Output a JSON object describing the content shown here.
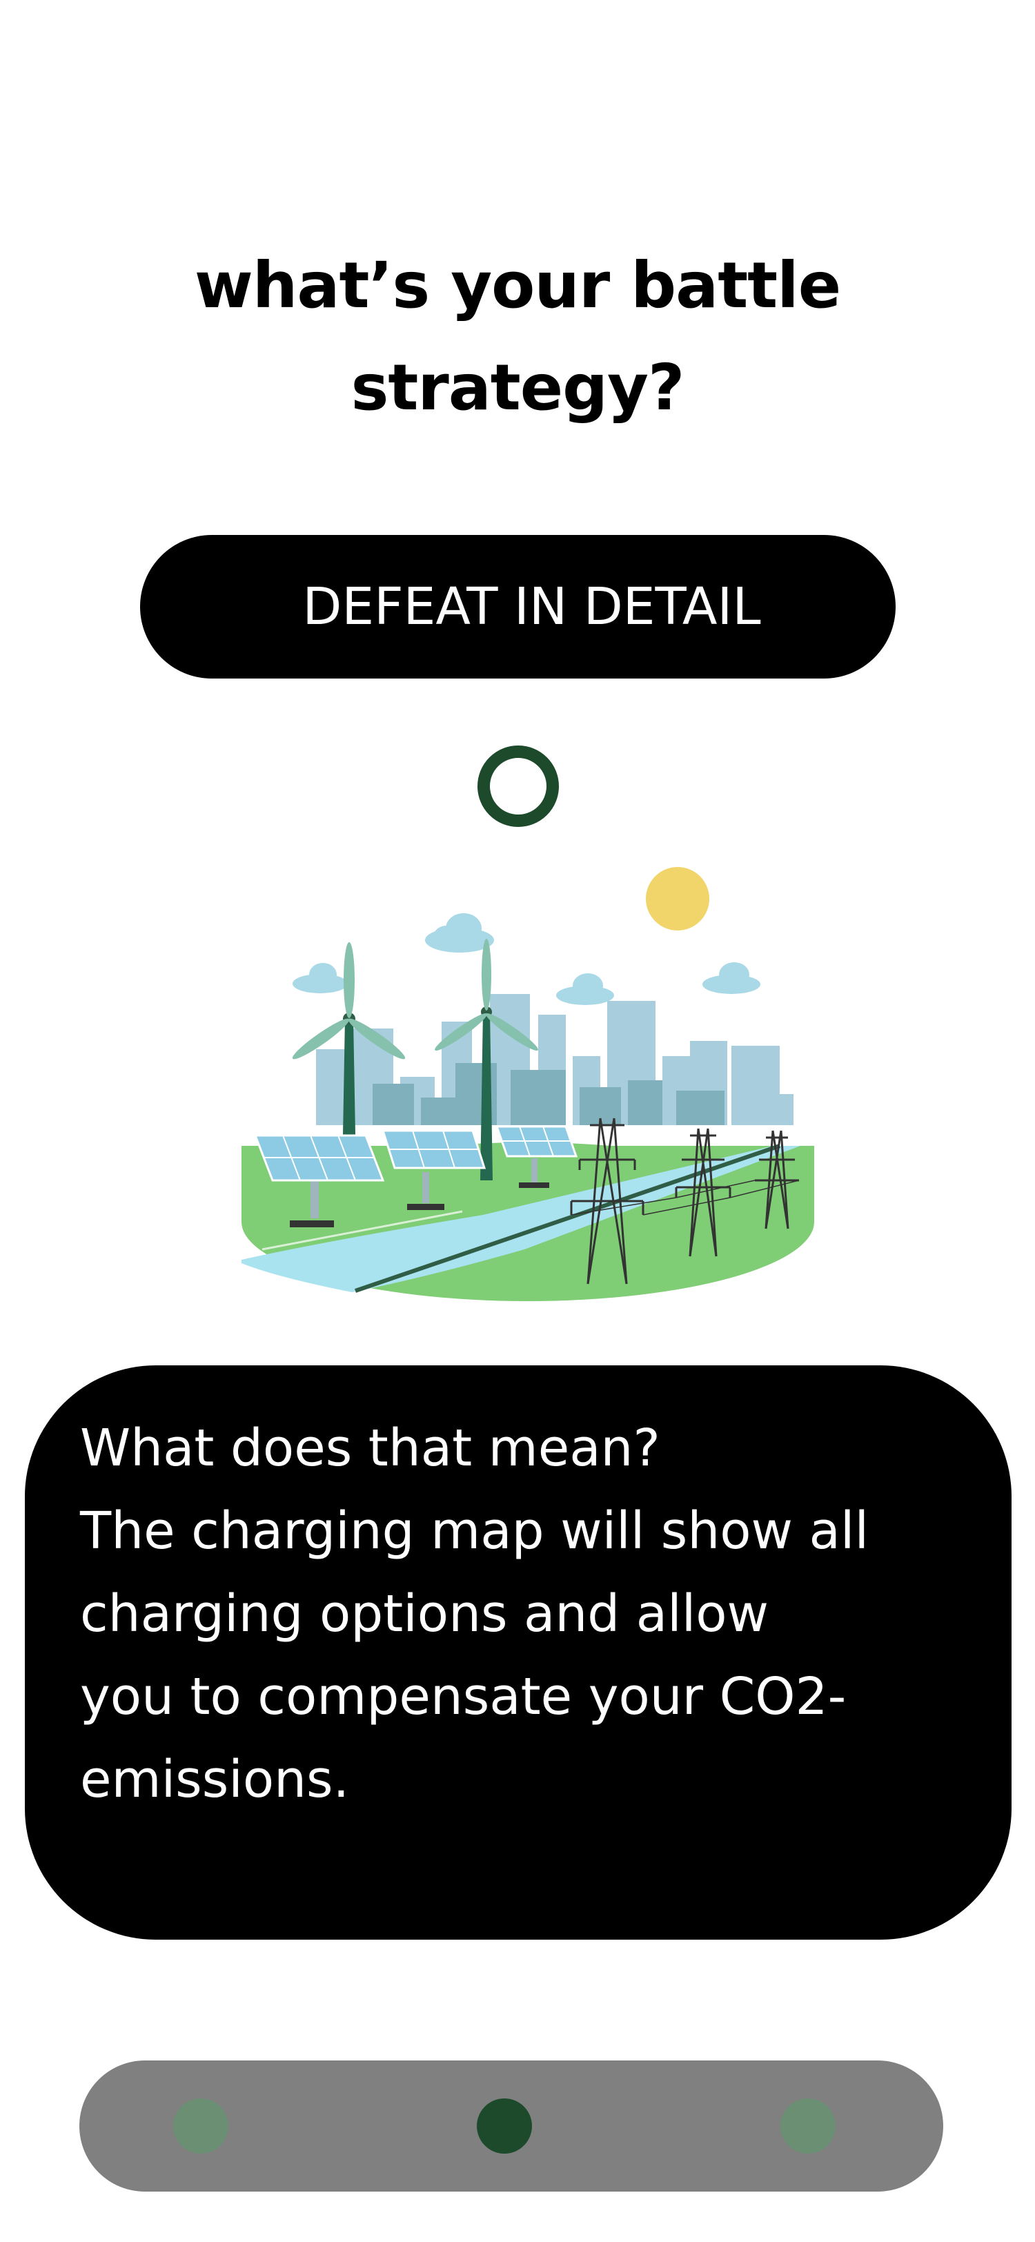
{
  "title": {
    "line1": "what’s your battle",
    "line2": "strategy?"
  },
  "strategy_button": {
    "label": "DEFEAT IN DETAIL"
  },
  "info_card": {
    "lines": [
      "What does that mean?",
      "The charging map will show all",
      "charging options and allow",
      "you to compensate your CO2-",
      "emissions."
    ]
  },
  "pager": {
    "total": 3,
    "active_index": 1
  },
  "colors": {
    "background": "#ffffff",
    "text": "#000000",
    "pill": "#000000",
    "ring": "#1e4a2c",
    "pager_bg": "#808080",
    "dot_active": "#1e4a2c",
    "dot_inactive": "#6a8f73"
  },
  "illustration": {
    "icon": "renewable-energy-city-illustration"
  }
}
